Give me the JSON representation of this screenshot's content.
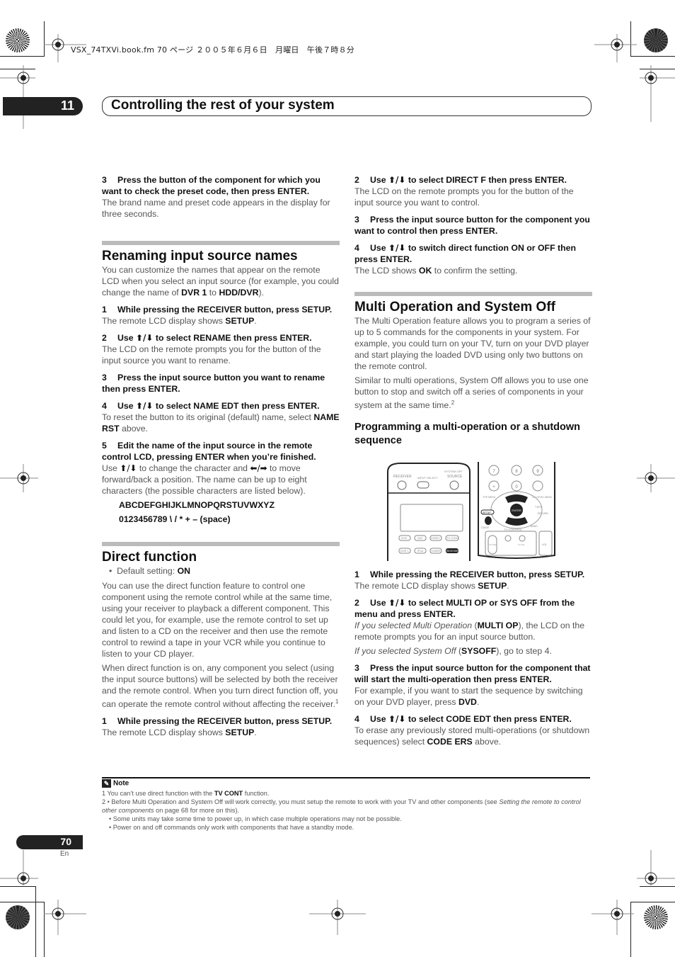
{
  "print_header": "VSX_74TXVi.book.fm  70 ページ  ２００５年６月６日　月曜日　午後７時８分",
  "chapter": {
    "number": "11",
    "title": "Controlling the rest of your system"
  },
  "left_column": {
    "intro_step": {
      "num": "3",
      "title": "Press the button of the component for which you want to check the preset code, then press ENTER.",
      "body": "The brand name and preset code appears in the display for three seconds."
    },
    "renaming": {
      "title": "Renaming input source names",
      "intro_pre": "You can customize the names that appear on the remote LCD when you select an input source (for example, you could change the name of ",
      "intro_b1": "DVR 1",
      "intro_mid": " to ",
      "intro_b2": "HDD/DVR",
      "intro_post": ").",
      "steps": [
        {
          "num": "1",
          "title": "While pressing the RECEIVER button, press SETUP.",
          "body_pre": "The remote LCD display shows ",
          "body_b": "SETUP",
          "body_post": "."
        },
        {
          "num": "2",
          "title_pre": "Use ",
          "title_post": " to select RENAME then press ENTER.",
          "body": "The LCD on the remote prompts you for the button of the input source you want to rename."
        },
        {
          "num": "3",
          "title": "Press the input source button you want to rename then press ENTER."
        },
        {
          "num": "4",
          "title_pre": "Use ",
          "title_post": " to select NAME EDT then press ENTER.",
          "body_pre": "To reset the button to its original (default) name, select ",
          "body_b": "NAME RST",
          "body_post": " above."
        },
        {
          "num": "5",
          "title": "Edit the name of the input source in the remote control LCD, pressing ENTER when you’re finished.",
          "body_a": "Use ",
          "body_b": " to change the character and ",
          "body_c": " to move forward/back a position. The name can be up to eight characters (the possible characters are listed below)."
        }
      ],
      "chars_line1": "ABCDEFGHIJKLMNOPQRSTUVWXYZ",
      "chars_line2": "0123456789 \\ / * + – (space)"
    },
    "direct": {
      "title": "Direct function",
      "default_label": "Default setting: ",
      "default_value": "ON",
      "para1": "You can use the direct function feature to control one component using the remote control while at the same time, using your receiver to playback a different component. This could let you, for example, use the remote control to set up and listen to a CD on the receiver and then use the remote control to rewind a tape in your VCR while you continue to listen to your CD player.",
      "para2": "When direct function is on, any component you select (using the input source buttons) will be selected by both the receiver and the remote control. When you turn direct function off, you can operate the remote control without affecting the receiver.",
      "para2_sup": "1",
      "step1": {
        "num": "1",
        "title": "While pressing the RECEIVER button, press SETUP.",
        "body_pre": "The remote LCD display shows ",
        "body_b": "SETUP",
        "body_post": "."
      }
    }
  },
  "right_column": {
    "direct_steps": [
      {
        "num": "2",
        "title_pre": "Use ",
        "title_post": " to select DIRECT F then press ENTER.",
        "body": "The LCD on the remote prompts you for the button of the input source you want to control."
      },
      {
        "num": "3",
        "title": "Press the input source button for the component you want to control then press ENTER."
      },
      {
        "num": "4",
        "title_pre": "Use ",
        "title_post": " to switch direct function ON or OFF then press ENTER.",
        "body_pre": "The LCD shows ",
        "body_b": "OK",
        "body_post": " to confirm the setting."
      }
    ],
    "multi": {
      "title": "Multi Operation and System Off",
      "para1": "The Multi Operation feature allows you to program a series of up to 5 commands for the components in your system. For example, you could turn on your TV, turn on your DVD player and start playing the loaded DVD using only two buttons on the remote control.",
      "para2": "Similar to multi operations, System Off allows you to use one button to stop and switch off a series of components in your system at the same time.",
      "para2_sup": "2",
      "subtitle": "Programming a multi-operation or a shutdown sequence",
      "remote_labels": {
        "receiver": "RECEIVER",
        "input_select": "INPUT SELECT",
        "system_off": "SYSTEM OFF",
        "source": "SOURCE",
        "dvd": "DVD",
        "sat": "SAT",
        "video1": "VIDEO 1",
        "tvcont": "TV CONT",
        "dvr1": "DVR 1",
        "ipod": "iPod",
        "tuner": "TUNER",
        "receiver_btn": "RECEIVER",
        "n7": "7",
        "n8": "8",
        "n9": "9",
        "n0": "0",
        "enter": "ENTER",
        "setup": "SETUP",
        "return": "RETURN",
        "tv_control": "TV CONTROL",
        "tv_vol": "TV VOL",
        "tv_ch": "TV CH",
        "vol": "VOL",
        "band": "BAND",
        "guide": "GUIDE",
        "top_menu": "TOP MENU",
        "ch_level": "CH LEVEL MENU",
        "t_edit": "T.EDIT"
      },
      "steps": [
        {
          "num": "1",
          "title": "While pressing the RECEIVER button, press SETUP.",
          "body_pre": "The remote LCD display shows ",
          "body_b": "SETUP",
          "body_post": "."
        },
        {
          "num": "2",
          "title_pre": "Use ",
          "title_post": " to select MULTI OP or SYS OFF from the menu and press ENTER.",
          "body1_i": "If you selected Multi Operation",
          "body1_pre": " (",
          "body1_b": "MULTI OP",
          "body1_post": "), the LCD on the remote prompts you for an input source button.",
          "body2_i": "If you selected System Off",
          "body2_pre": " (",
          "body2_b": "SYSOFF",
          "body2_post": "), go to step 4."
        },
        {
          "num": "3",
          "title": "Press the input source button for the component that will start the multi-operation then press ENTER.",
          "body_pre": "For example, if you want to start the sequence by switching on your DVD player, press ",
          "body_b": "DVD",
          "body_post": "."
        },
        {
          "num": "4",
          "title_pre": "Use ",
          "title_post": " to select CODE EDT then press ENTER.",
          "body_pre": "To erase any previously stored multi-operations (or shutdown sequences) select ",
          "body_b": "CODE ERS",
          "body_post": " above."
        }
      ]
    }
  },
  "arrows": {
    "updown": "⬆/⬇",
    "leftright": "⬅/➡"
  },
  "notes": {
    "heading": "Note",
    "n1_pre": "1 You can’t use direct function with the ",
    "n1_b": "TV CONT",
    "n1_post": " function.",
    "n2_pre": "2  •  Before Multi Operation and System Off will work correctly, you must setup the remote to work with your TV and other components (see ",
    "n2_i": "Setting the remote to control other components",
    "n2_post": " on page 68 for more on this).",
    "n3": "•  Some units may take some time to power up, in which case multiple operations may not be possible.",
    "n4": "•  Power on and off commands only work with components that have a standby mode."
  },
  "footer": {
    "page": "70",
    "lang": "En"
  }
}
